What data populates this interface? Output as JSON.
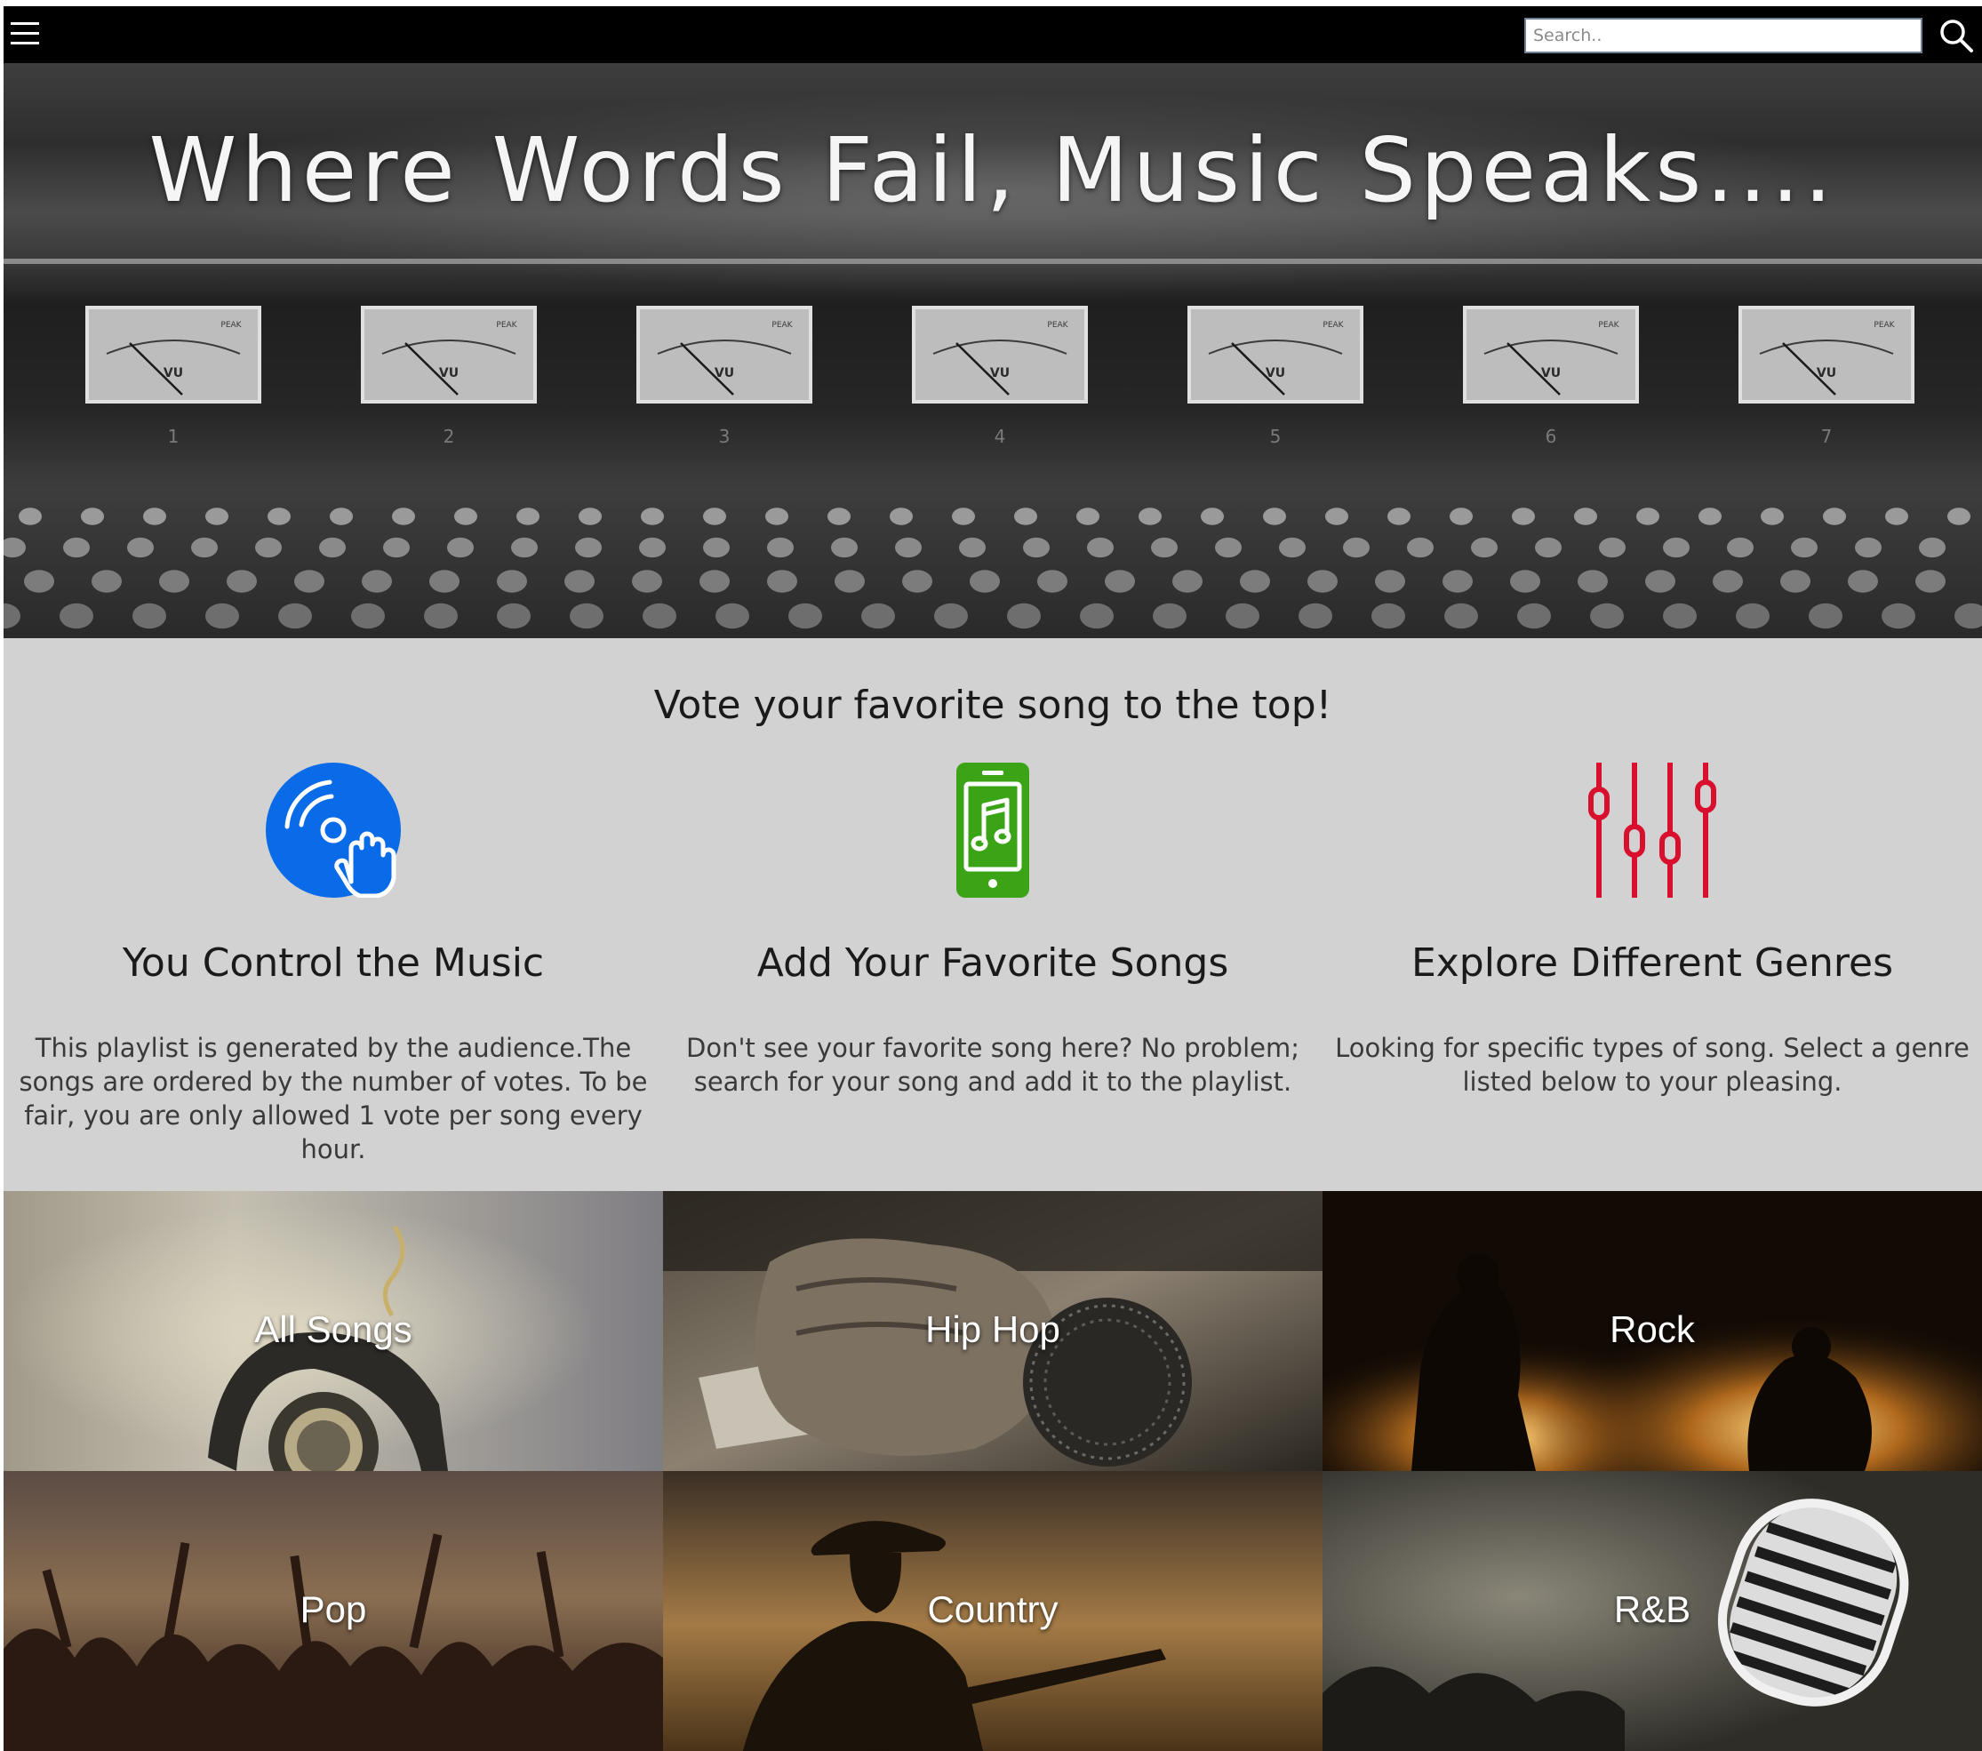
{
  "nav": {
    "search_placeholder": "Search..",
    "menu_icon": "hamburger-menu-icon",
    "search_icon": "magnifier-search-icon"
  },
  "hero": {
    "title": "Where Words Fail, Music Speaks....",
    "meter_label": "VU",
    "meter_peak_label": "PEAK",
    "channel_numbers": [
      "1",
      "2",
      "3",
      "4",
      "5",
      "6",
      "7"
    ]
  },
  "features": {
    "heading": "Vote your favorite song to the top!",
    "items": [
      {
        "icon": "vinyl-hand-icon",
        "title": "You Control the Music",
        "text": "This playlist is generated by the audience.The songs are ordered by the number of votes. To be fair, you are only allowed 1 vote per song every hour.",
        "color": "#0a6be8"
      },
      {
        "icon": "phone-music-icon",
        "title": "Add Your Favorite Songs",
        "text": "Don't see your favorite song here? No problem; search for your song and add it to the playlist.",
        "color": "#3aa316"
      },
      {
        "icon": "equalizer-sliders-icon",
        "title": "Explore Different Genres",
        "text": "Looking for specific types of song. Select a genre listed below to your pleasing.",
        "color": "#d8102e"
      }
    ]
  },
  "genres": {
    "tiles": [
      {
        "label": "All Songs"
      },
      {
        "label": "Hip Hop"
      },
      {
        "label": "Rock"
      },
      {
        "label": "Pop"
      },
      {
        "label": "Country"
      },
      {
        "label": "R&B"
      }
    ]
  }
}
